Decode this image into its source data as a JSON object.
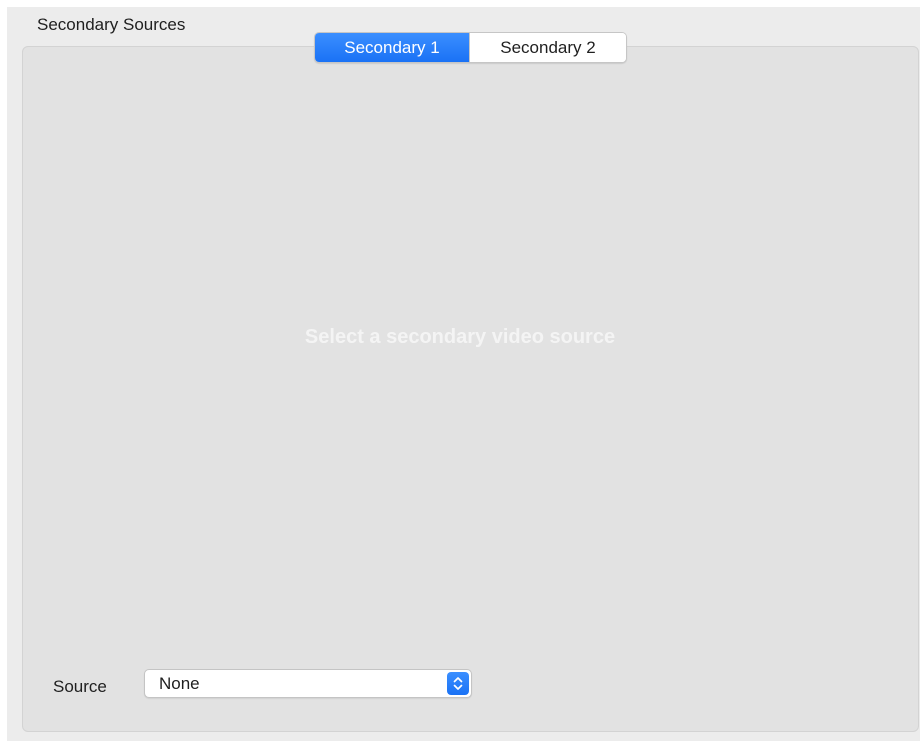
{
  "section": {
    "title": "Secondary Sources"
  },
  "tabs": [
    {
      "label": "Secondary 1",
      "selected": true
    },
    {
      "label": "Secondary 2",
      "selected": false
    }
  ],
  "preview": {
    "placeholder": "Select a secondary video source"
  },
  "source": {
    "label": "Source",
    "selected_value": "None"
  },
  "colors": {
    "accent": "#1a72f5",
    "panel": "#e2e2e2",
    "window": "#ececec"
  },
  "icons": {
    "stepper": "chevron-up-down-icon"
  }
}
